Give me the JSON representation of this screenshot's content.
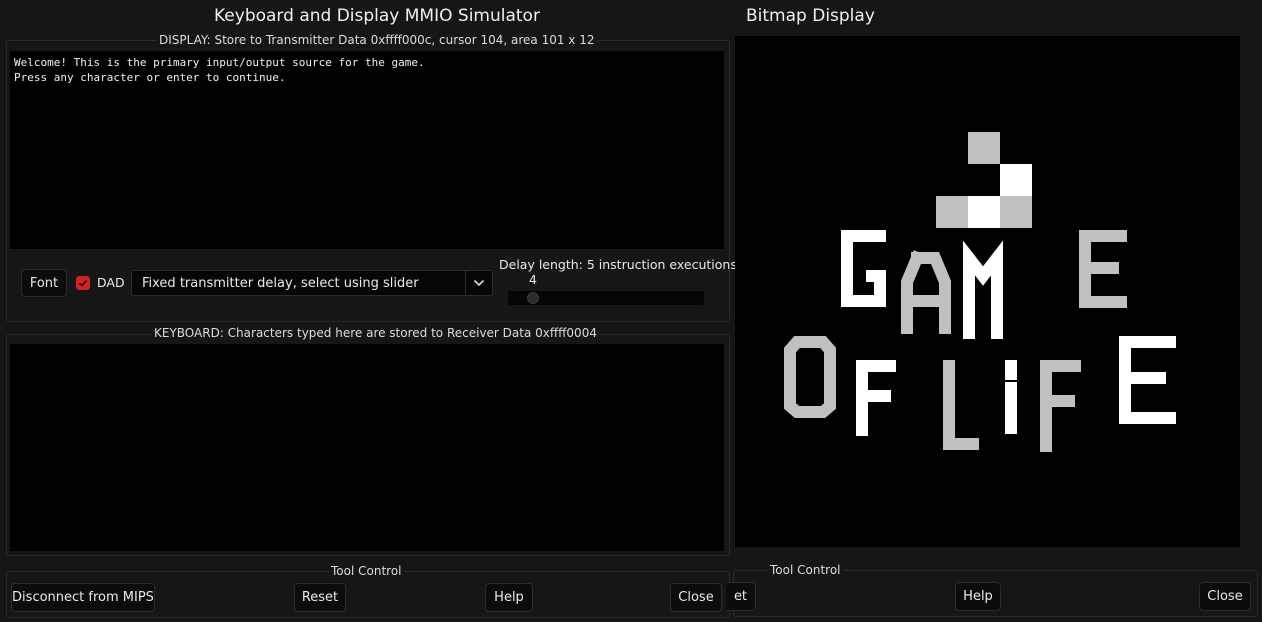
{
  "mmio": {
    "window_title": "Keyboard and Display MMIO Simulator",
    "display_label": "DISPLAY: Store to Transmitter Data 0xffff000c, cursor 104, area 101 x 12",
    "display_text": "Welcome! This is the primary input/output source for the game.\nPress any character or enter to continue.",
    "font_button": "Font",
    "dad_label": "DAD",
    "dad_checked": true,
    "delay_mode": "Fixed transmitter delay, select using slider",
    "delay_length_label": "Delay length: 5 instruction executions",
    "slider_value": "4",
    "keyboard_label": "KEYBOARD: Characters typed here are stored to Receiver Data 0xffff0004",
    "keyboard_text": "",
    "tool_control_label": "Tool Control",
    "buttons": {
      "disconnect": "Disconnect from MIPS",
      "reset": "Reset",
      "help": "Help",
      "close": "Close"
    }
  },
  "bitmap": {
    "window_title": "Bitmap Display",
    "image_text": "GAME OF LIFE",
    "tool_control_label": "Tool Control",
    "buttons": {
      "reset_partial": "et",
      "help": "Help",
      "close": "Close"
    }
  },
  "colors": {
    "window_bg": "#161616",
    "terminal_bg": "#000000",
    "accent_checkbox": "#d0231f",
    "pixel_white": "#ffffff",
    "pixel_gray": "#c0c0c0"
  }
}
